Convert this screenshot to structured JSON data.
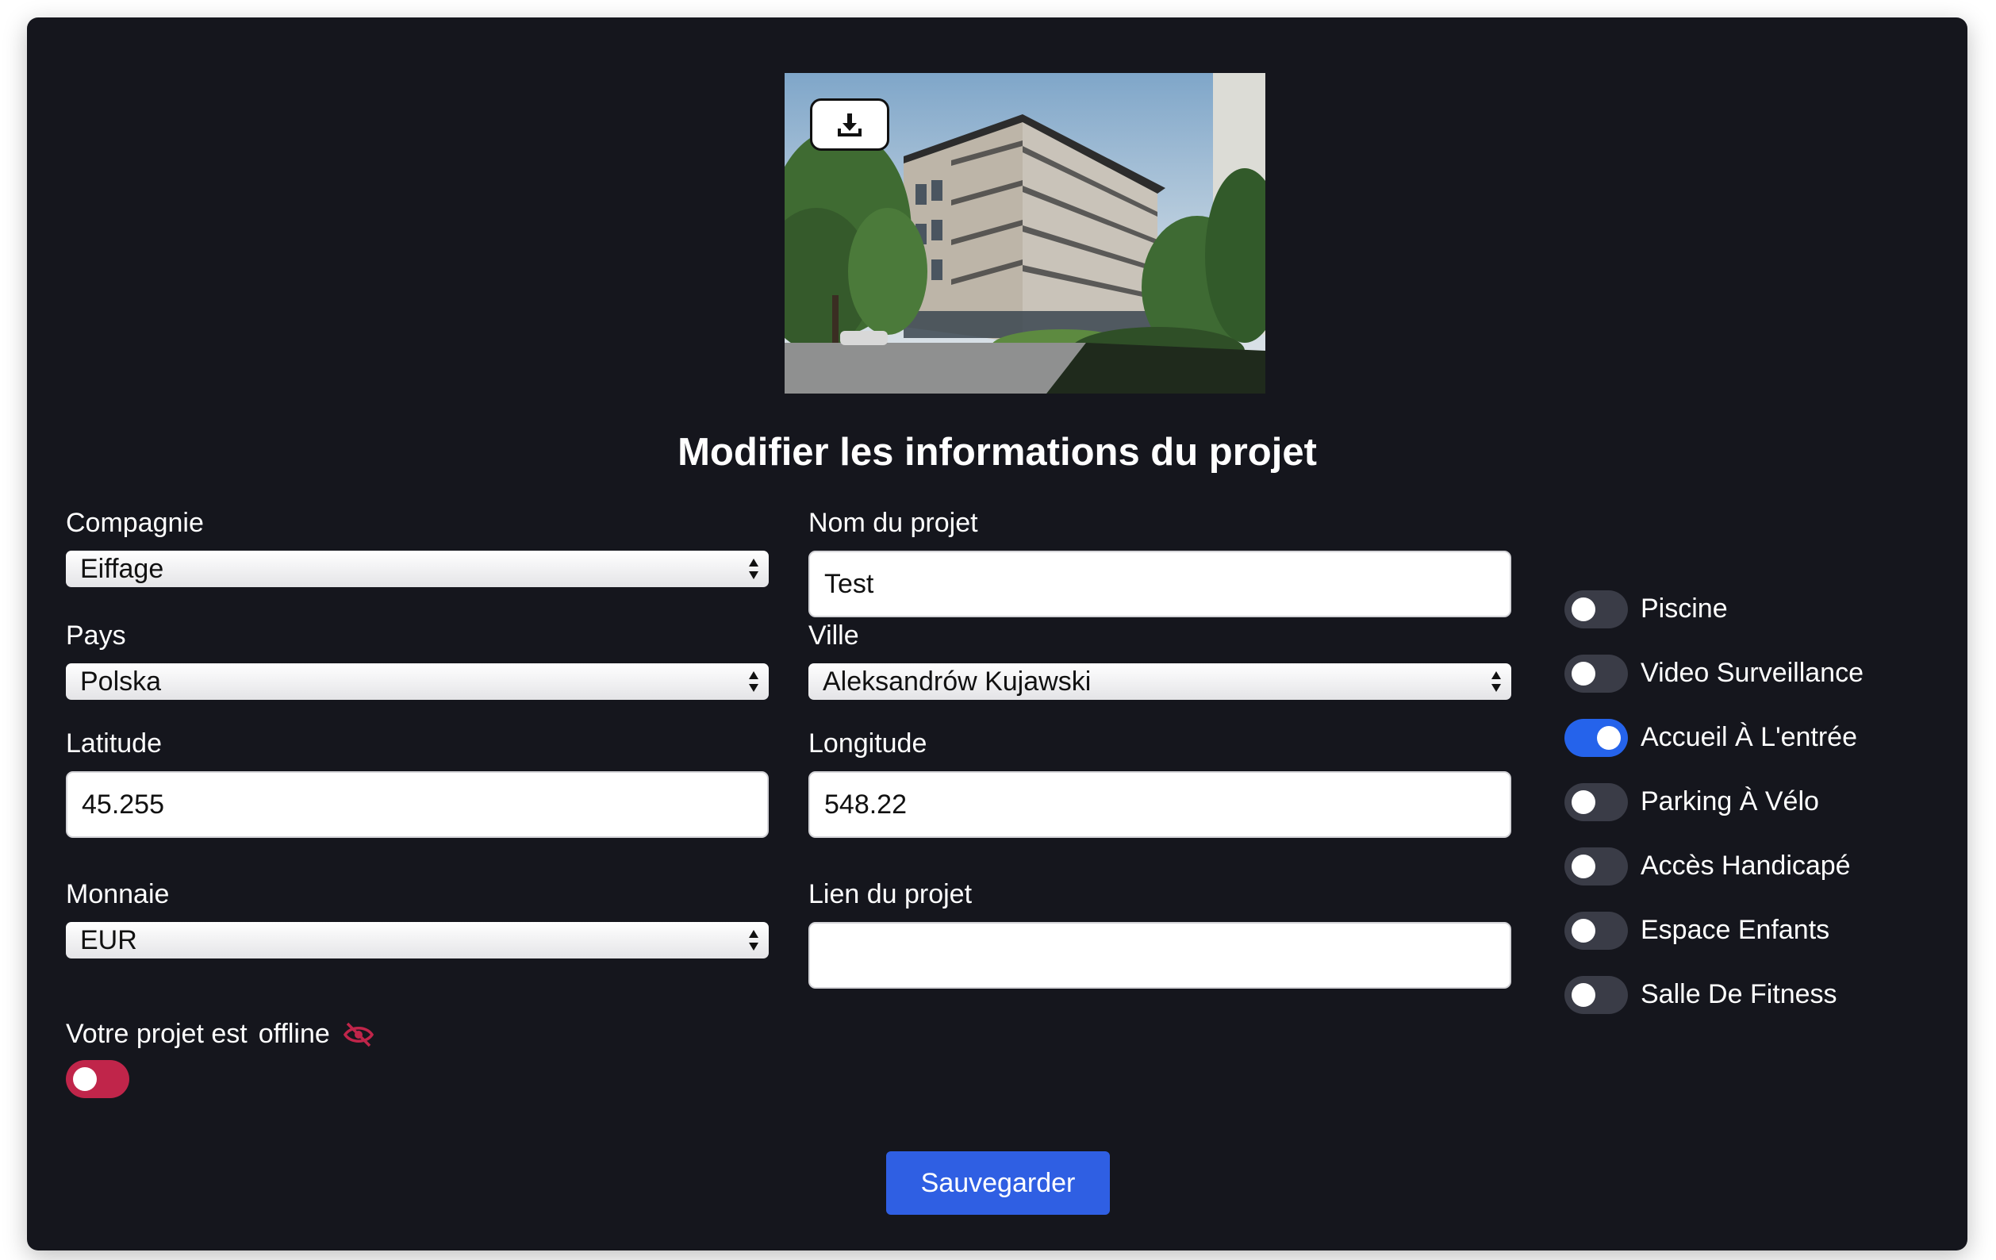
{
  "upload": {
    "icon": "download-icon"
  },
  "page_title": "Modifier les informations du projet",
  "form": {
    "company": {
      "label": "Compagnie",
      "value": "Eiffage"
    },
    "project_name": {
      "label": "Nom du projet",
      "value": "Test"
    },
    "country": {
      "label": "Pays",
      "value": "Polska"
    },
    "city": {
      "label": "Ville",
      "value": "Aleksandrów Kujawski"
    },
    "latitude": {
      "label": "Latitude",
      "value": "45.255"
    },
    "longitude": {
      "label": "Longitude",
      "value": "548.22"
    },
    "currency": {
      "label": "Monnaie",
      "value": "EUR"
    },
    "project_link": {
      "label": "Lien du projet",
      "value": ""
    },
    "offline": {
      "label_prefix": "Votre projet est",
      "label_status": "offline",
      "icon": "eye-slash-icon",
      "enabled": true
    }
  },
  "amenities": [
    {
      "label": "Piscine",
      "on": false
    },
    {
      "label": "Video Surveillance",
      "on": false
    },
    {
      "label": "Accueil À L'entrée",
      "on": true
    },
    {
      "label": "Parking À Vélo",
      "on": false
    },
    {
      "label": "Accès Handicapé",
      "on": false
    },
    {
      "label": "Espace Enfants",
      "on": false
    },
    {
      "label": "Salle De Fitness",
      "on": false
    }
  ],
  "save_label": "Sauvegarder",
  "colors": {
    "background": "#15161d",
    "accent": "#2f5fe3",
    "offline": "#c0254a"
  }
}
